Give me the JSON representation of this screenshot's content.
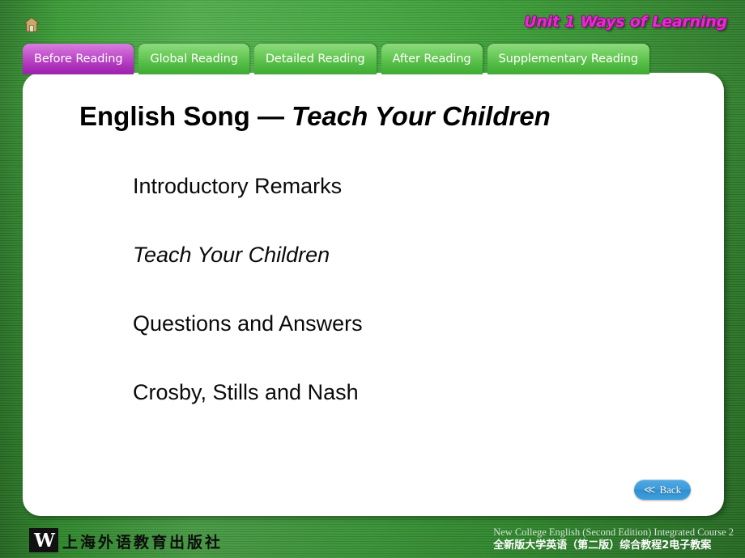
{
  "header": {
    "home_icon": "home-icon",
    "unit_title": "Unit 1 Ways of Learning"
  },
  "tabs": [
    {
      "label": "Before Reading",
      "active": true
    },
    {
      "label": "Global Reading",
      "active": false
    },
    {
      "label": "Detailed Reading",
      "active": false
    },
    {
      "label": "After Reading",
      "active": false
    },
    {
      "label": "Supplementary Reading",
      "active": false
    }
  ],
  "slide": {
    "title_plain": "English Song — ",
    "title_italic": "Teach Your Children",
    "menu_items": [
      {
        "label": "Introductory Remarks",
        "italic": false
      },
      {
        "label": "Teach Your Children",
        "italic": true
      },
      {
        "label": "Questions and Answers",
        "italic": false
      },
      {
        "label": "Crosby, Stills and Nash",
        "italic": false
      }
    ]
  },
  "back_button": {
    "icon": "double-chevron-left-icon",
    "glyph": "≪",
    "label": "Back"
  },
  "footer": {
    "logo_mark": "W",
    "logo_text": "上海外语教育出版社",
    "line_en": "New College English (Second Edition) Integrated Course 2",
    "line_zh": "全新版大学英语（第二版）综合教程2电子教案"
  },
  "colors": {
    "background_green": "#3da338",
    "active_tab_magenta": "#ab2fba",
    "inactive_tab_green": "#4cb83f",
    "unit_title_pink": "#e62ad0",
    "menu_bar_green": "#c6f4c4",
    "back_button_blue": "#3d9bd9",
    "panel_white": "#ffffff"
  }
}
